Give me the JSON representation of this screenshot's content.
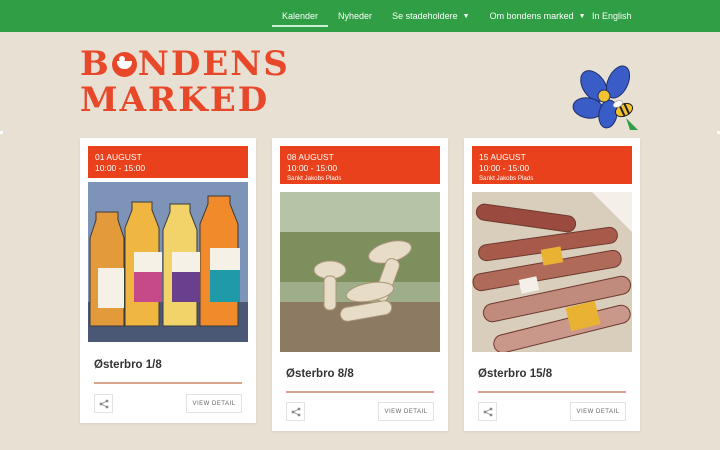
{
  "nav": {
    "items": [
      {
        "label": "Kalender",
        "active": true
      },
      {
        "label": "Nyheder"
      },
      {
        "label": "Se stadeholdere",
        "dropdown": true
      },
      {
        "label": "Om bondens marked",
        "dropdown": true
      }
    ],
    "lang": "In English"
  },
  "logo": {
    "line1_a": "B",
    "line1_b": "NDENS",
    "line2": "MARKED"
  },
  "colors": {
    "nav": "#2f9e45",
    "accent": "#e8411b",
    "background": "#e7e0d3"
  },
  "cards": [
    {
      "date": "01 AUGUST",
      "time": "10:00 - 15:00",
      "place": "",
      "title": "Østerbro 1/8",
      "detail": "VIEW DETAIL",
      "share_icon": "share-icon"
    },
    {
      "date": "08 AUGUST",
      "time": "10:00 - 15:00",
      "place": "Sankt Jakobs Plads",
      "title": "Østerbro 8/8",
      "detail": "VIEW DETAIL",
      "share_icon": "share-icon"
    },
    {
      "date": "15 AUGUST",
      "time": "10:00 - 15:00",
      "place": "Sankt Jakobs Plads",
      "title": "Østerbro 15/8",
      "detail": "VIEW DETAIL",
      "share_icon": "share-icon"
    }
  ]
}
